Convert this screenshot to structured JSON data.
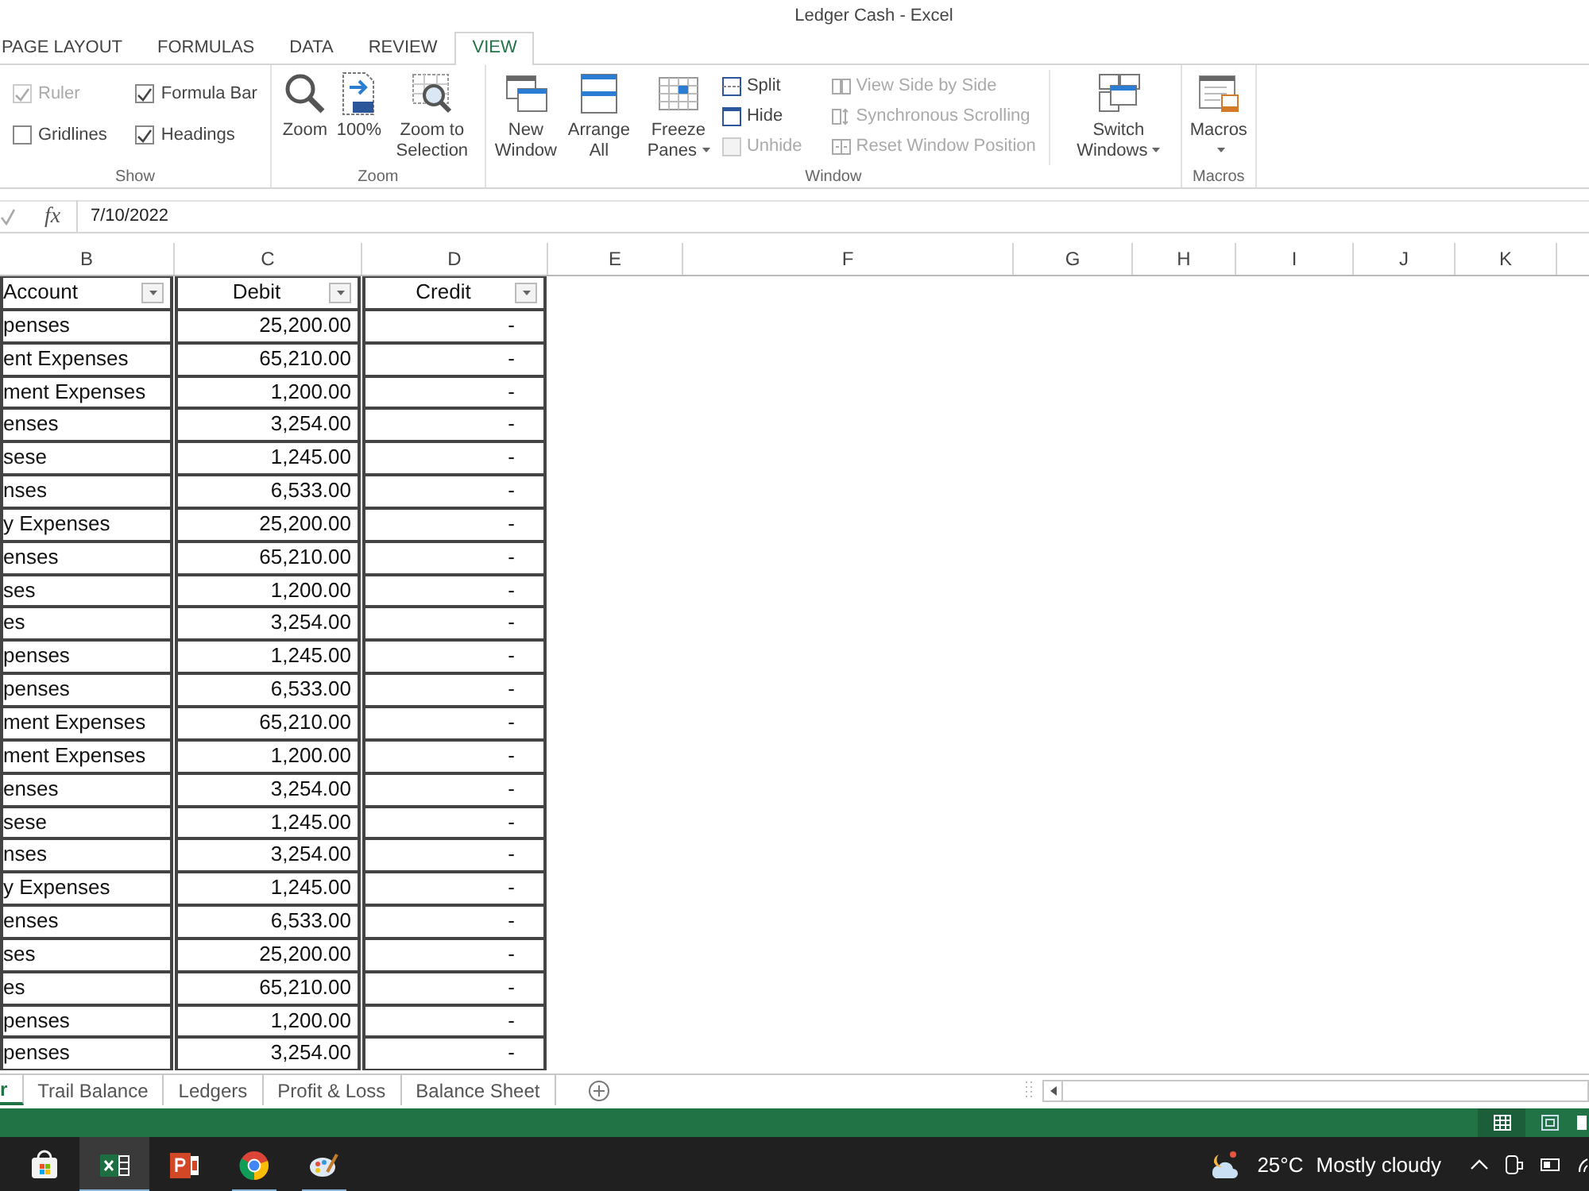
{
  "window": {
    "title": "Ledger Cash - Excel"
  },
  "ribbon_tabs": [
    {
      "label": "PAGE LAYOUT",
      "selected": false
    },
    {
      "label": "FORMULAS",
      "selected": false
    },
    {
      "label": "DATA",
      "selected": false
    },
    {
      "label": "REVIEW",
      "selected": false
    },
    {
      "label": "VIEW",
      "selected": true
    }
  ],
  "ribbon_groups": [
    {
      "kind": "show",
      "label": "Show",
      "options": [
        {
          "label": "Ruler",
          "checked": true,
          "disabled": true
        },
        {
          "label": "Formula Bar",
          "checked": true,
          "disabled": false
        },
        {
          "label": "Gridlines",
          "checked": false,
          "disabled": false
        },
        {
          "label": "Headings",
          "checked": true,
          "disabled": false
        }
      ]
    },
    {
      "kind": "zoom",
      "label": "Zoom",
      "buttons": [
        {
          "label": "Zoom",
          "dropdown": false
        },
        {
          "label": "100%",
          "dropdown": false
        },
        {
          "label": "Zoom to Selection",
          "dropdown": false
        }
      ]
    },
    {
      "kind": "window",
      "label": "Window",
      "buttons": [
        {
          "label": "New Window",
          "dropdown": false
        },
        {
          "label": "Arrange All",
          "dropdown": false
        },
        {
          "label": "Freeze Panes",
          "dropdown": true
        }
      ],
      "small": [
        {
          "label": "Split",
          "disabled": false
        },
        {
          "label": "Hide",
          "disabled": false
        },
        {
          "label": "Unhide",
          "disabled": true
        }
      ],
      "compare": [
        {
          "label": "View Side by Side",
          "disabled": true
        },
        {
          "label": "Synchronous Scrolling",
          "disabled": true
        },
        {
          "label": "Reset Window Position",
          "disabled": true
        }
      ],
      "switch": {
        "label": "Switch Windows",
        "dropdown": true
      }
    },
    {
      "kind": "macros",
      "label": "Macros",
      "buttons": [
        {
          "label": "Macros",
          "dropdown": true
        }
      ]
    }
  ],
  "formula_bar": {
    "fx": "fx",
    "value": "7/10/2022"
  },
  "sheet": {
    "columns": [
      "B",
      "C",
      "D",
      "E",
      "F",
      "G",
      "H",
      "I",
      "J",
      "K"
    ],
    "header": [
      "Account",
      "Debit",
      "Credit"
    ],
    "rows": [
      [
        "penses",
        "25,200.00",
        "-"
      ],
      [
        "ent Expenses",
        "65,210.00",
        "-"
      ],
      [
        "ment Expenses",
        "1,200.00",
        "-"
      ],
      [
        "enses",
        "3,254.00",
        "-"
      ],
      [
        "sese",
        "1,245.00",
        "-"
      ],
      [
        "nses",
        "6,533.00",
        "-"
      ],
      [
        "y Expenses",
        "25,200.00",
        "-"
      ],
      [
        "enses",
        "65,210.00",
        "-"
      ],
      [
        "ses",
        "1,200.00",
        "-"
      ],
      [
        "es",
        "3,254.00",
        "-"
      ],
      [
        "penses",
        "1,245.00",
        "-"
      ],
      [
        "penses",
        "6,533.00",
        "-"
      ],
      [
        "ment Expenses",
        "65,210.00",
        "-"
      ],
      [
        "ment Expenses",
        "1,200.00",
        "-"
      ],
      [
        "enses",
        "3,254.00",
        "-"
      ],
      [
        "sese",
        "1,245.00",
        "-"
      ],
      [
        "nses",
        "3,254.00",
        "-"
      ],
      [
        "y Expenses",
        "1,245.00",
        "-"
      ],
      [
        "enses",
        "6,533.00",
        "-"
      ],
      [
        "ses",
        "25,200.00",
        "-"
      ],
      [
        "es",
        "65,210.00",
        "-"
      ],
      [
        "penses",
        "1,200.00",
        "-"
      ],
      [
        "penses",
        "3,254.00",
        "-"
      ]
    ]
  },
  "sheet_tabs": [
    {
      "label": "r",
      "selected": true
    },
    {
      "label": "Trail Balance",
      "selected": false
    },
    {
      "label": "Ledgers",
      "selected": false
    },
    {
      "label": "Profit & Loss",
      "selected": false
    },
    {
      "label": "Balance Sheet",
      "selected": false
    }
  ],
  "taskbar": {
    "apps": [
      {
        "kind": "store",
        "selected": false,
        "running": false
      },
      {
        "kind": "excel",
        "selected": true,
        "running": true
      },
      {
        "kind": "powerpoint",
        "selected": false,
        "running": false
      },
      {
        "kind": "browser",
        "selected": false,
        "running": true
      },
      {
        "kind": "paint",
        "selected": false,
        "running": true
      }
    ],
    "weather": {
      "temp": "25°C",
      "text": "Mostly cloudy"
    }
  }
}
